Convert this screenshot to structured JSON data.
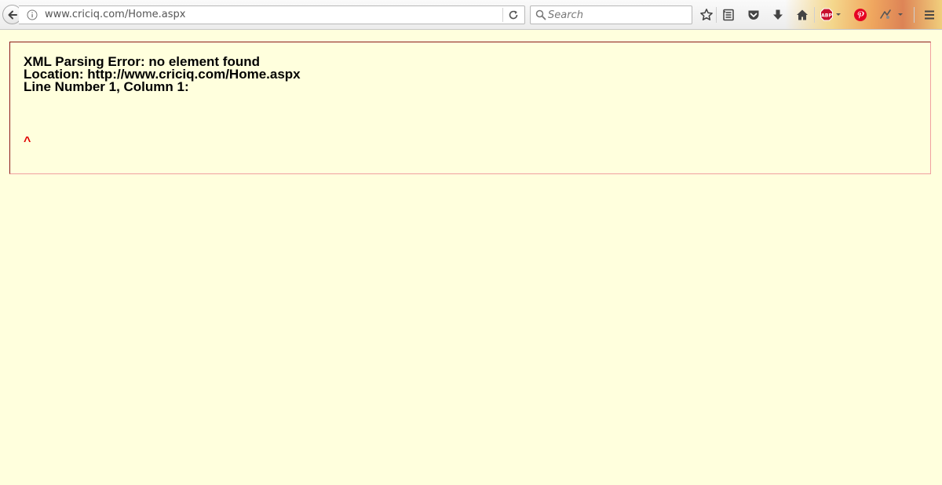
{
  "browser": {
    "url": "www.criciq.com/Home.aspx",
    "search_placeholder": "Search",
    "abp_label": "ABP"
  },
  "error": {
    "line1": "XML Parsing Error: no element found",
    "line2": "Location: http://www.criciq.com/Home.aspx",
    "line3": "Line Number 1, Column 1:",
    "caret": "^"
  },
  "icons": [
    "back-arrow-icon",
    "info-icon",
    "reload-icon",
    "search-icon",
    "star-icon",
    "reading-list-icon",
    "pocket-icon",
    "download-icon",
    "home-icon",
    "adblock-icon",
    "pinterest-icon",
    "extension-icon",
    "menu-icon"
  ],
  "colors": {
    "page_background": "#ffffdd",
    "error_border": "#8b1a1a",
    "caret": "#e00000",
    "abp": "#c8102e",
    "pinterest": "#e60023"
  }
}
